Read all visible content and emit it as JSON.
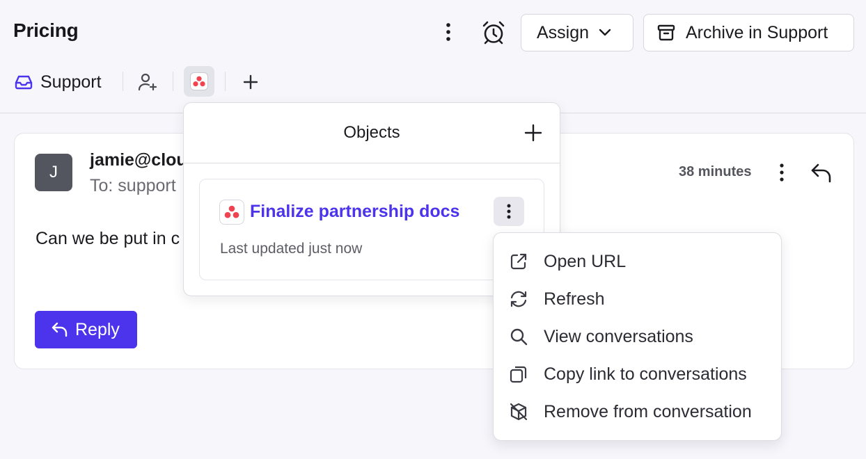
{
  "header": {
    "title": "Pricing",
    "assign_label": "Assign",
    "archive_label": "Archive in Support"
  },
  "tags": {
    "inbox_label": "Support"
  },
  "message": {
    "avatar_initial": "J",
    "sender": "jamie@clou",
    "to": "To: support",
    "time": "38 minutes",
    "body": "Can we be put in c",
    "reply_label": "Reply"
  },
  "objects_popover": {
    "title": "Objects",
    "item": {
      "title": "Finalize partnership docs",
      "subtitle": "Last updated just now"
    }
  },
  "context_menu": {
    "items": [
      {
        "label": "Open URL",
        "icon": "external-link-icon"
      },
      {
        "label": "Refresh",
        "icon": "refresh-icon"
      },
      {
        "label": "View conversations",
        "icon": "search-icon"
      },
      {
        "label": "Copy link to conversations",
        "icon": "copy-icon"
      },
      {
        "label": "Remove from conversation",
        "icon": "remove-box-icon"
      }
    ]
  },
  "colors": {
    "accent": "#4b34ec",
    "asana_red": "#f0424f",
    "background": "#f6f6fb"
  }
}
